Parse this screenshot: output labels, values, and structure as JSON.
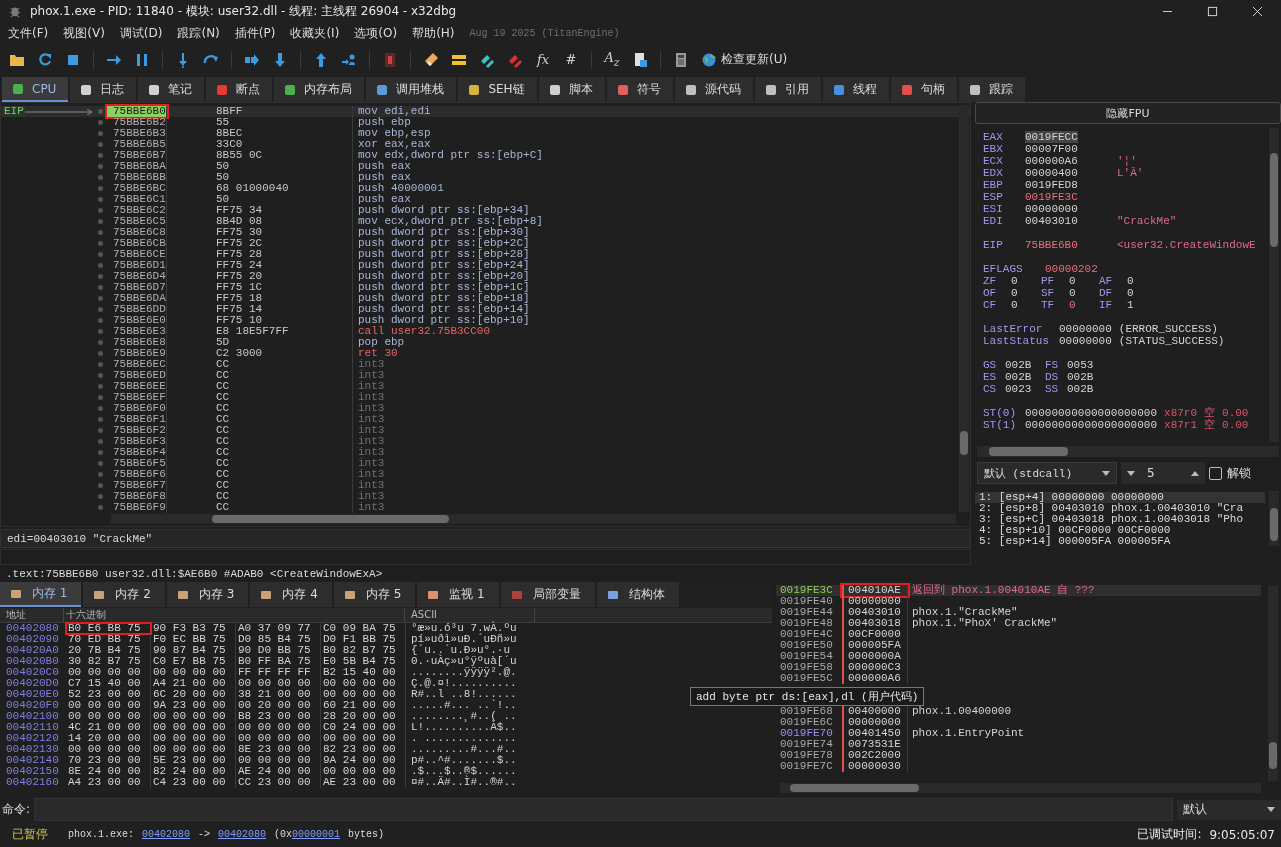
{
  "window": {
    "title": "phox.1.exe - PID: 11840 - 模块: user32.dll - 线程: 主线程 26904 - x32dbg"
  },
  "menu": [
    "文件(F)",
    "视图(V)",
    "调试(D)",
    "跟踪(N)",
    "插件(P)",
    "收藏夹(I)",
    "选项(O)",
    "帮助(H)"
  ],
  "build_note": "Aug 19 2025 (TitanEngine)",
  "toolbar": {
    "glyphs": [
      "fx",
      "#",
      "A$_{z}$"
    ],
    "update_label": "检查更新(U)"
  },
  "tabs": [
    {
      "label": "CPU",
      "selected": true
    },
    {
      "label": "日志",
      "selected": false
    },
    {
      "label": "笔记",
      "selected": false
    },
    {
      "label": "断点",
      "selected": false
    },
    {
      "label": "内存布局",
      "selected": false
    },
    {
      "label": "调用堆栈",
      "selected": false
    },
    {
      "label": "SEH链",
      "selected": false
    },
    {
      "label": "脚本",
      "selected": false
    },
    {
      "label": "符号",
      "selected": false
    },
    {
      "label": "源代码",
      "selected": false
    },
    {
      "label": "引用",
      "selected": false
    },
    {
      "label": "线程",
      "selected": false
    },
    {
      "label": "句柄",
      "selected": false
    },
    {
      "label": "跟踪",
      "selected": false
    }
  ],
  "disasm": {
    "eip_label": "EIP",
    "rows": [
      {
        "address": "75BBE6B0",
        "bytes": "8BFF",
        "instruction": "mov edi,edi",
        "kind": "normal",
        "selected": true,
        "boxed": true
      },
      {
        "address": "75BBE6B2",
        "bytes": "55",
        "instruction": "push ebp",
        "kind": "normal",
        "selected": false,
        "boxed": false
      },
      {
        "address": "75BBE6B3",
        "bytes": "8BEC",
        "instruction": "mov ebp,esp",
        "kind": "normal",
        "selected": false,
        "boxed": false
      },
      {
        "address": "75BBE6B5",
        "bytes": "33C0",
        "instruction": "xor eax,eax",
        "kind": "normal",
        "selected": false,
        "boxed": false
      },
      {
        "address": "75BBE6B7",
        "bytes": "8B55 0C",
        "instruction": "mov edx,dword ptr ss:[ebp+C]",
        "kind": "normal",
        "selected": false,
        "boxed": false
      },
      {
        "address": "75BBE6BA",
        "bytes": "50",
        "instruction": "push eax",
        "kind": "normal",
        "selected": false,
        "boxed": false
      },
      {
        "address": "75BBE6BB",
        "bytes": "50",
        "instruction": "push eax",
        "kind": "normal",
        "selected": false,
        "boxed": false
      },
      {
        "address": "75BBE6BC",
        "bytes": "68 01000040",
        "instruction": "push 40000001",
        "kind": "normal",
        "selected": false,
        "boxed": false
      },
      {
        "address": "75BBE6C1",
        "bytes": "50",
        "instruction": "push eax",
        "kind": "normal",
        "selected": false,
        "boxed": false
      },
      {
        "address": "75BBE6C2",
        "bytes": "FF75 34",
        "instruction": "push dword ptr ss:[ebp+34]",
        "kind": "normal",
        "selected": false,
        "boxed": false
      },
      {
        "address": "75BBE6C5",
        "bytes": "8B4D 08",
        "instruction": "mov ecx,dword ptr ss:[ebp+8]",
        "kind": "normal",
        "selected": false,
        "boxed": false
      },
      {
        "address": "75BBE6C8",
        "bytes": "FF75 30",
        "instruction": "push dword ptr ss:[ebp+30]",
        "kind": "normal",
        "selected": false,
        "boxed": false
      },
      {
        "address": "75BBE6CB",
        "bytes": "FF75 2C",
        "instruction": "push dword ptr ss:[ebp+2C]",
        "kind": "normal",
        "selected": false,
        "boxed": false
      },
      {
        "address": "75BBE6CE",
        "bytes": "FF75 28",
        "instruction": "push dword ptr ss:[ebp+28]",
        "kind": "normal",
        "selected": false,
        "boxed": false
      },
      {
        "address": "75BBE6D1",
        "bytes": "FF75 24",
        "instruction": "push dword ptr ss:[ebp+24]",
        "kind": "normal",
        "selected": false,
        "boxed": false
      },
      {
        "address": "75BBE6D4",
        "bytes": "FF75 20",
        "instruction": "push dword ptr ss:[ebp+20]",
        "kind": "normal",
        "selected": false,
        "boxed": false
      },
      {
        "address": "75BBE6D7",
        "bytes": "FF75 1C",
        "instruction": "push dword ptr ss:[ebp+1C]",
        "kind": "normal",
        "selected": false,
        "boxed": false
      },
      {
        "address": "75BBE6DA",
        "bytes": "FF75 18",
        "instruction": "push dword ptr ss:[ebp+18]",
        "kind": "normal",
        "selected": false,
        "boxed": false
      },
      {
        "address": "75BBE6DD",
        "bytes": "FF75 14",
        "instruction": "push dword ptr ss:[ebp+14]",
        "kind": "normal",
        "selected": false,
        "boxed": false
      },
      {
        "address": "75BBE6E0",
        "bytes": "FF75 10",
        "instruction": "push dword ptr ss:[ebp+10]",
        "kind": "normal",
        "selected": false,
        "boxed": false
      },
      {
        "address": "75BBE6E3",
        "bytes": "E8 18E5F7FF",
        "instruction": "call user32.75B3CC00",
        "kind": "call",
        "selected": false,
        "boxed": false
      },
      {
        "address": "75BBE6E8",
        "bytes": "5D",
        "instruction": "pop ebp",
        "kind": "normal",
        "selected": false,
        "boxed": false
      },
      {
        "address": "75BBE6E9",
        "bytes": "C2 3000",
        "instruction": "ret 30",
        "kind": "ret",
        "selected": false,
        "boxed": false
      },
      {
        "address": "75BBE6EC",
        "bytes": "CC",
        "instruction": "int3",
        "kind": "int3",
        "selected": false,
        "boxed": false
      },
      {
        "address": "75BBE6ED",
        "bytes": "CC",
        "instruction": "int3",
        "kind": "int3",
        "selected": false,
        "boxed": false
      },
      {
        "address": "75BBE6EE",
        "bytes": "CC",
        "instruction": "int3",
        "kind": "int3",
        "selected": false,
        "boxed": false
      },
      {
        "address": "75BBE6EF",
        "bytes": "CC",
        "instruction": "int3",
        "kind": "int3",
        "selected": false,
        "boxed": false
      },
      {
        "address": "75BBE6F0",
        "bytes": "CC",
        "instruction": "int3",
        "kind": "int3",
        "selected": false,
        "boxed": false
      },
      {
        "address": "75BBE6F1",
        "bytes": "CC",
        "instruction": "int3",
        "kind": "int3",
        "selected": false,
        "boxed": false
      },
      {
        "address": "75BBE6F2",
        "bytes": "CC",
        "instruction": "int3",
        "kind": "int3",
        "selected": false,
        "boxed": false
      },
      {
        "address": "75BBE6F3",
        "bytes": "CC",
        "instruction": "int3",
        "kind": "int3",
        "selected": false,
        "boxed": false
      },
      {
        "address": "75BBE6F4",
        "bytes": "CC",
        "instruction": "int3",
        "kind": "int3",
        "selected": false,
        "boxed": false
      },
      {
        "address": "75BBE6F5",
        "bytes": "CC",
        "instruction": "int3",
        "kind": "int3",
        "selected": false,
        "boxed": false
      },
      {
        "address": "75BBE6F6",
        "bytes": "CC",
        "instruction": "int3",
        "kind": "int3",
        "selected": false,
        "boxed": false
      },
      {
        "address": "75BBE6F7",
        "bytes": "CC",
        "instruction": "int3",
        "kind": "int3",
        "selected": false,
        "boxed": false
      },
      {
        "address": "75BBE6F8",
        "bytes": "CC",
        "instruction": "int3",
        "kind": "int3",
        "selected": false,
        "boxed": false
      },
      {
        "address": "75BBE6F9",
        "bytes": "CC",
        "instruction": "int3",
        "kind": "int3",
        "selected": false,
        "boxed": false
      }
    ]
  },
  "info_line": "edi=00403010 \"CrackMe\"",
  "location_line": ".text:75BBE6B0 user32.dll:$AE6B0 #ADAB0 <CreateWindowExA>",
  "registers": {
    "hide_fpu_button": "隐藏FPU",
    "general": [
      {
        "name": "EAX",
        "value": "0019FECC",
        "changed": false,
        "selected": true
      },
      {
        "name": "EBX",
        "value": "00007F00",
        "changed": false,
        "selected": false
      },
      {
        "name": "ECX",
        "value": "000000A6",
        "comment": "'¦'",
        "changed": false,
        "selected": false
      },
      {
        "name": "EDX",
        "value": "00000400",
        "comment": "L'Ȁ'",
        "changed": false,
        "selected": false
      },
      {
        "name": "EBP",
        "value": "0019FED8",
        "changed": false,
        "selected": false
      },
      {
        "name": "ESP",
        "value": "0019FE3C",
        "changed": true,
        "selected": false
      },
      {
        "name": "ESI",
        "value": "00000000",
        "changed": false,
        "selected": false
      },
      {
        "name": "EDI",
        "value": "00403010",
        "comment": "\"CrackMe\"",
        "changed": false,
        "selected": false
      }
    ],
    "eip": {
      "name": "EIP",
      "value": "75BBE6B0",
      "comment": "<user32.CreateWindowE",
      "changed": true
    },
    "eflags": {
      "name": "EFLAGS",
      "value": "00000202",
      "changed": true
    },
    "flags": [
      {
        "name": "ZF",
        "value": "0",
        "changed": false
      },
      {
        "name": "PF",
        "value": "0",
        "changed": false
      },
      {
        "name": "AF",
        "value": "0",
        "changed": false
      },
      {
        "name": "OF",
        "value": "0",
        "changed": false
      },
      {
        "name": "SF",
        "value": "0",
        "changed": false
      },
      {
        "name": "DF",
        "value": "0",
        "changed": false
      },
      {
        "name": "CF",
        "value": "0",
        "changed": false
      },
      {
        "name": "TF",
        "value": "0",
        "changed": true
      },
      {
        "name": "IF",
        "value": "1",
        "changed": false
      }
    ],
    "status": [
      {
        "name": "LastError",
        "value": "00000000",
        "comment": "(ERROR_SUCCESS)"
      },
      {
        "name": "LastStatus",
        "value": "00000000",
        "comment": "(STATUS_SUCCESS)"
      }
    ],
    "segments": [
      {
        "name": "GS",
        "value": "002B"
      },
      {
        "name": "FS",
        "value": "0053"
      },
      {
        "name": "ES",
        "value": "002B"
      },
      {
        "name": "DS",
        "value": "002B"
      },
      {
        "name": "CS",
        "value": "0023"
      },
      {
        "name": "SS",
        "value": "002B"
      }
    ],
    "fpu": [
      {
        "name": "ST(0)",
        "value": "00000000000000000000",
        "register": "x87r0",
        "tag": "空",
        "float": "0.00"
      },
      {
        "name": "ST(1)",
        "value": "00000000000000000000",
        "register": "x87r1",
        "tag": "空",
        "float": "0.00"
      }
    ]
  },
  "call_args": {
    "convention": "默认 (stdcall)",
    "count": "5",
    "unlock": {
      "label": "解锁",
      "checked": false
    },
    "lines": [
      {
        "text": "1: [esp+4] 00000000 00000000",
        "selected": true
      },
      {
        "text": "2: [esp+8] 00403010 phox.1.00403010 \"Cra",
        "selected": false
      },
      {
        "text": "3: [esp+C] 00403018 phox.1.00403018 \"Pho",
        "selected": false
      },
      {
        "text": "4: [esp+10] 00CF0000 00CF0000",
        "selected": false
      },
      {
        "text": "5: [esp+14] 000005FA 000005FA",
        "selected": false
      }
    ]
  },
  "dump_tabs": [
    {
      "label": "内存 1",
      "selected": true
    },
    {
      "label": "内存 2",
      "selected": false
    },
    {
      "label": "内存 3",
      "selected": false
    },
    {
      "label": "内存 4",
      "selected": false
    },
    {
      "label": "内存 5",
      "selected": false
    },
    {
      "label": "监视 1",
      "selected": false
    },
    {
      "label": "局部变量",
      "selected": false
    },
    {
      "label": "结构体",
      "selected": false
    }
  ],
  "dump": {
    "columns": [
      "地址",
      "十六进制",
      "ASCII"
    ],
    "rows": [
      {
        "address": "00402080",
        "groups": [
          "B0 E6 BB 75",
          "90 F3 B3 75",
          "A0 37 09 77",
          "C0 09 BA 75"
        ],
        "ascii": "°æ»u.ó³u 7.wÀ.ºu",
        "boxed": true
      },
      {
        "address": "00402090",
        "groups": [
          "70 ED BB 75",
          "F0 EC BB 75",
          "D0 85 B4 75",
          "D0 F1 BB 75"
        ],
        "ascii": "pí»uðì»uÐ.´uÐñ»u",
        "boxed": false
      },
      {
        "address": "004020A0",
        "groups": [
          "20 7B B4 75",
          "90 87 B4 75",
          "90 D0 BB 75",
          "B0 82 B7 75"
        ],
        "ascii": " {´u..´u.Ð»u°.·u",
        "boxed": false
      },
      {
        "address": "004020B0",
        "groups": [
          "30 82 B7 75",
          "C0 E7 BB 75",
          "B0 FF BA 75",
          "E0 5B B4 75"
        ],
        "ascii": "0.·uÀç»u°ÿºuà[´u",
        "boxed": false
      },
      {
        "address": "004020C0",
        "groups": [
          "00 00 00 00",
          "00 00 00 00",
          "FF FF FF FF",
          "B2 15 40 00"
        ],
        "ascii": "........ÿÿÿÿ².@.",
        "boxed": false
      },
      {
        "address": "004020D0",
        "groups": [
          "C7 15 40 00",
          "A4 21 00 00",
          "00 00 00 00",
          "00 00 00 00"
        ],
        "ascii": "Ç.@.¤!..........",
        "boxed": false
      },
      {
        "address": "004020E0",
        "groups": [
          "52 23 00 00",
          "6C 20 00 00",
          "38 21 00 00",
          "00 00 00 00"
        ],
        "ascii": "R#..l ..8!......",
        "boxed": false
      },
      {
        "address": "004020F0",
        "groups": [
          "00 00 00 00",
          "9A 23 00 00",
          "00 20 00 00",
          "60 21 00 00"
        ],
        "ascii": ".....#... ..`!..",
        "boxed": false
      },
      {
        "address": "00402100",
        "groups": [
          "00 00 00 00",
          "00 00 00 00",
          "B8 23 00 00",
          "28 20 00 00"
        ],
        "ascii": "........¸#..( ..",
        "boxed": false
      },
      {
        "address": "00402110",
        "groups": [
          "4C 21 00 00",
          "00 00 00 00",
          "00 00 00 00",
          "C0 24 00 00"
        ],
        "ascii": "L!..........À$..",
        "boxed": false
      },
      {
        "address": "00402120",
        "groups": [
          "14 20 00 00",
          "00 00 00 00",
          "00 00 00 00",
          "00 00 00 00"
        ],
        "ascii": ". ..............",
        "boxed": false
      },
      {
        "address": "00402130",
        "groups": [
          "00 00 00 00",
          "00 00 00 00",
          "8E 23 00 00",
          "82 23 00 00"
        ],
        "ascii": ".........#...#..",
        "boxed": false
      },
      {
        "address": "00402140",
        "groups": [
          "70 23 00 00",
          "5E 23 00 00",
          "00 00 00 00",
          "9A 24 00 00"
        ],
        "ascii": "p#..^#.......$..",
        "boxed": false
      },
      {
        "address": "00402150",
        "groups": [
          "8E 24 00 00",
          "82 24 00 00",
          "AE 24 00 00",
          "00 00 00 00"
        ],
        "ascii": ".$...$..®$......",
        "boxed": false
      },
      {
        "address": "00402160",
        "groups": [
          "A4 23 00 00",
          "C4 23 00 00",
          "CC 23 00 00",
          "AE 23 00 00"
        ],
        "ascii": "¤#..Ä#..Ì#..®#..",
        "boxed": false
      }
    ]
  },
  "stack": [
    {
      "kind": "return",
      "address": "0019FE3C",
      "value": "004010AE",
      "comment": "返回到 phox.1.004010AE 自 ???",
      "color": "#8fd14f",
      "selected": true,
      "boxed": true
    },
    {
      "kind": "plain",
      "address": "0019FE40",
      "value": "00000000",
      "selected": false,
      "boxed": false
    },
    {
      "kind": "plain",
      "address": "0019FE44",
      "value": "00403010",
      "comment": "phox.1.\"CrackMe\"",
      "selected": false,
      "boxed": false
    },
    {
      "kind": "plain",
      "address": "0019FE48",
      "value": "00403018",
      "comment": "phox.1.\"PhoX' CrackMe\"",
      "selected": false,
      "boxed": false
    },
    {
      "kind": "plain",
      "address": "0019FE4C",
      "value": "00CF0000",
      "selected": false,
      "boxed": false
    },
    {
      "kind": "plain",
      "address": "0019FE50",
      "value": "000005FA",
      "selected": false,
      "boxed": false
    },
    {
      "kind": "plain",
      "address": "0019FE54",
      "value": "0000000A",
      "selected": false,
      "boxed": false
    },
    {
      "kind": "plain",
      "address": "0019FE58",
      "value": "000000C3",
      "selected": false,
      "boxed": false
    },
    {
      "kind": "plain",
      "address": "0019FE5C",
      "value": "000000A6",
      "selected": false,
      "boxed": false
    },
    {
      "kind": "tooltip",
      "text": "add byte ptr ds:[eax],dl (用户代码)"
    },
    {
      "kind": "plain",
      "address": "0019FE68",
      "value": "00400000",
      "comment": "phox.1.00400000",
      "selected": false,
      "boxed": false
    },
    {
      "kind": "plain",
      "address": "0019FE6C",
      "value": "00000000",
      "selected": false,
      "boxed": false
    },
    {
      "kind": "plain",
      "address": "0019FE70",
      "value": "00401450",
      "comment": "phox.1.EntryPoint",
      "color": "#9c8cff",
      "selected": false,
      "boxed": false
    },
    {
      "kind": "plain",
      "address": "0019FE74",
      "value": "0073531E",
      "selected": false,
      "boxed": false
    },
    {
      "kind": "plain",
      "address": "0019FE78",
      "value": "002C2000",
      "selected": false,
      "boxed": false
    },
    {
      "kind": "plain",
      "address": "0019FE7C",
      "value": "00000030",
      "selected": false,
      "boxed": false
    }
  ],
  "command": {
    "label": "命令:",
    "mode": "默认"
  },
  "status": {
    "state": "已暂停",
    "module": "phox.1.exe:",
    "from": "00402080",
    "arrow": "->",
    "to": "00402080",
    "size_prefix": "(0x",
    "size": "00000001",
    "size_suffix": "bytes)",
    "elapsed_label": "已调试时间:",
    "elapsed": "9:05:05:07"
  }
}
